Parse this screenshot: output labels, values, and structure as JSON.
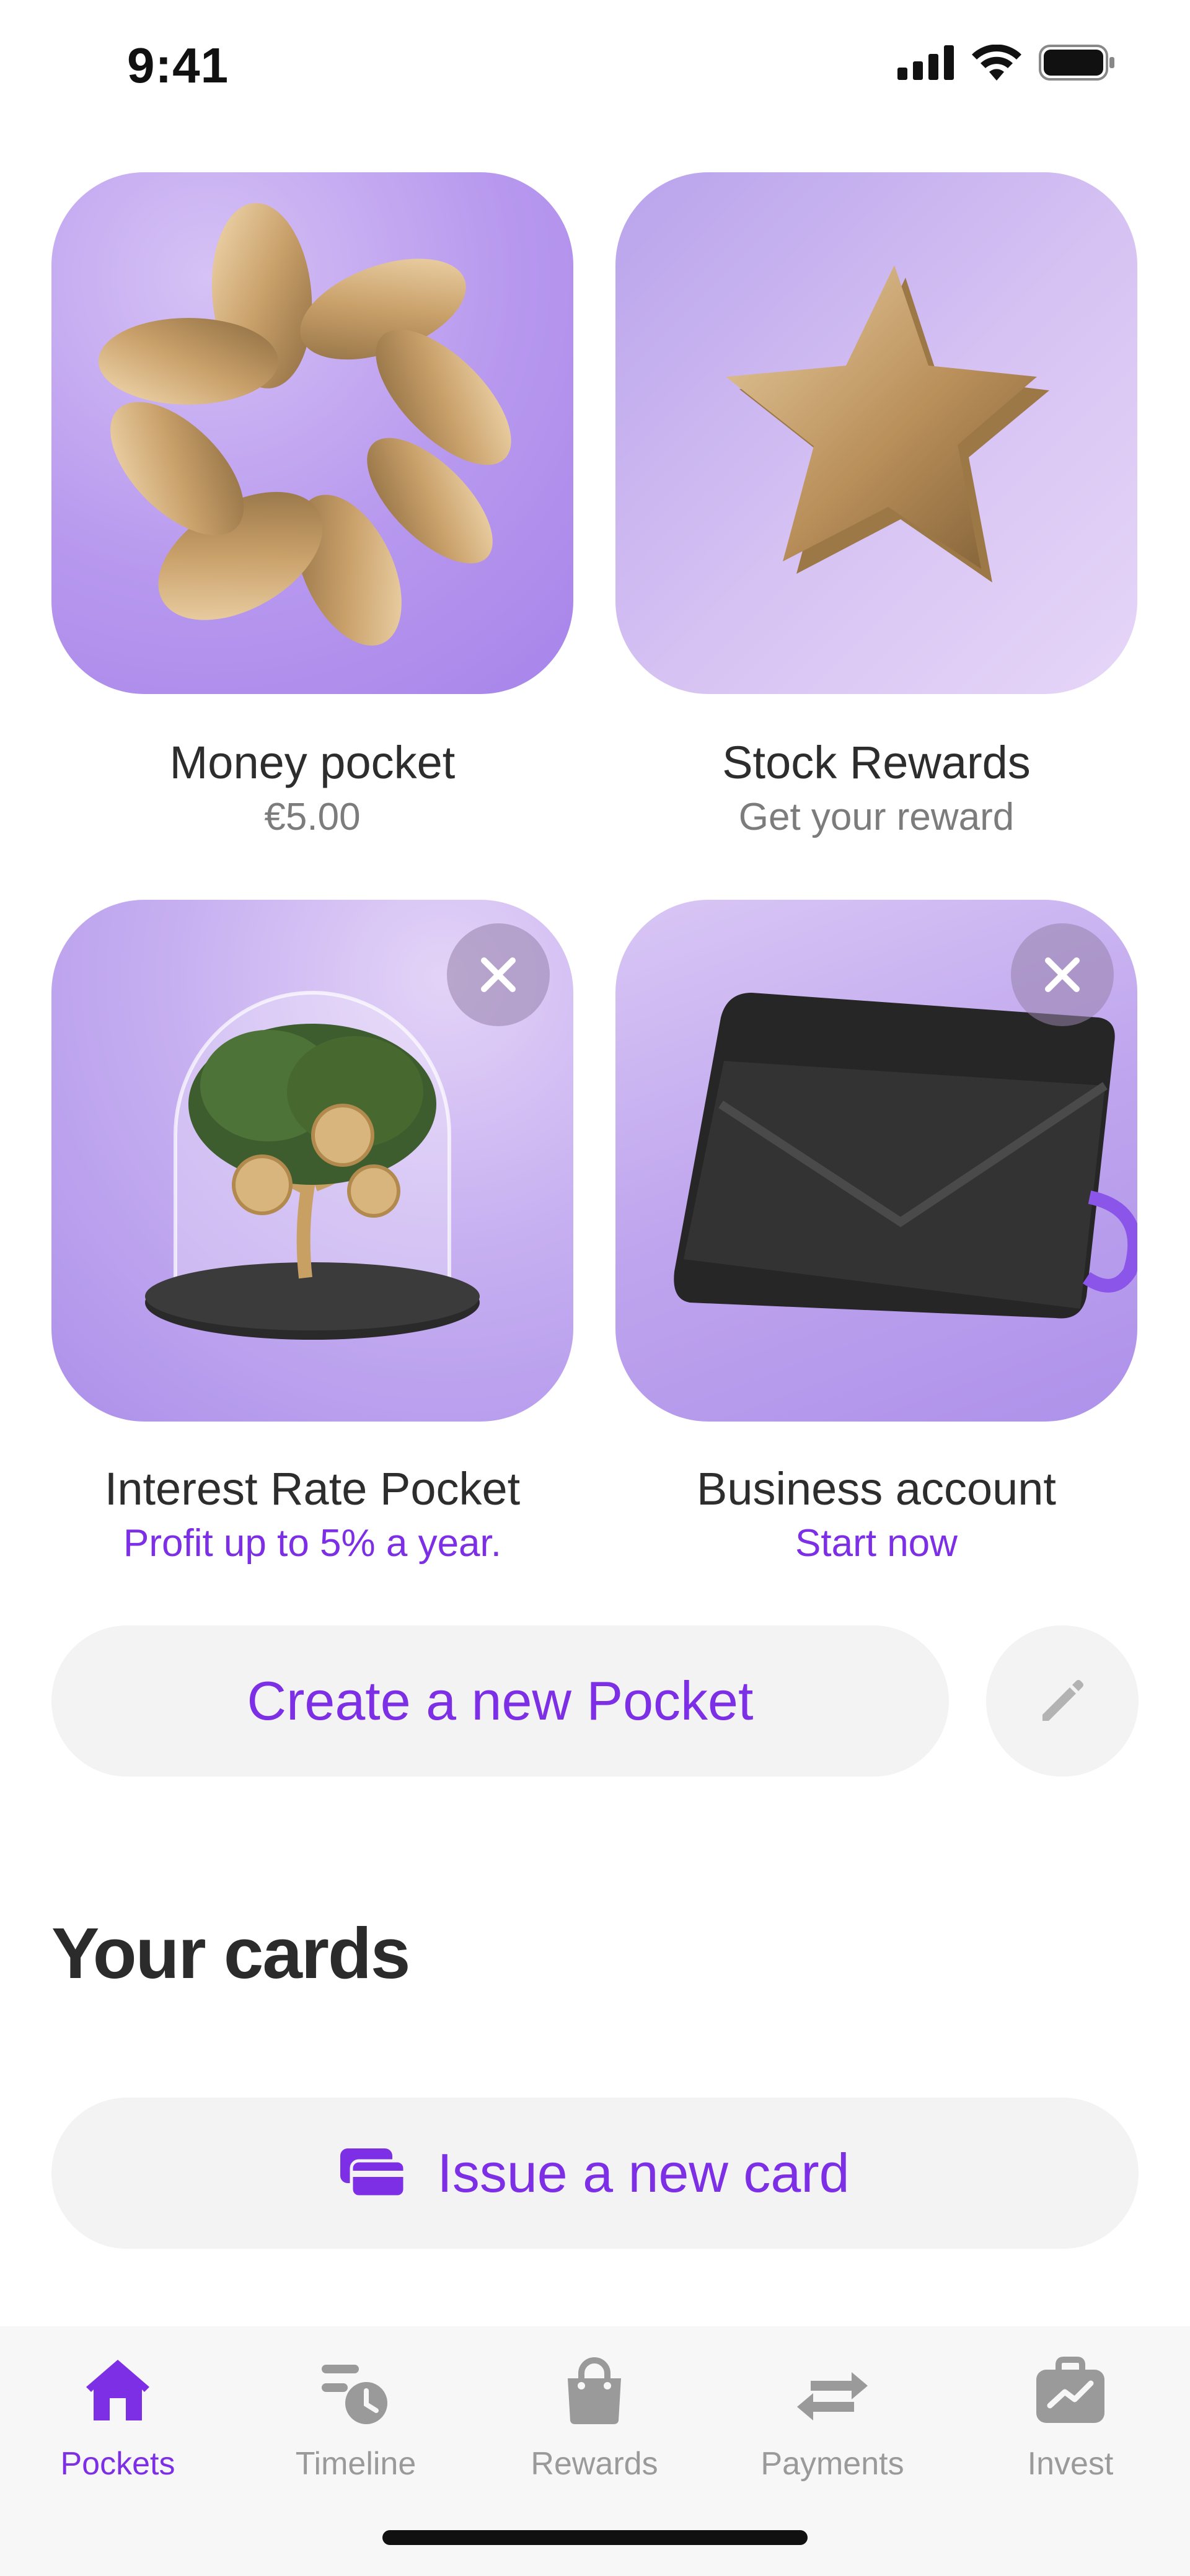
{
  "status_bar": {
    "time": "9:41"
  },
  "colors": {
    "accent": "#7d2fe6",
    "muted": "#9a9a9a",
    "tile_bg": "#b798ee"
  },
  "pockets": [
    {
      "title": "Money pocket",
      "subtitle": "€5.00",
      "icon": "coins-illustration",
      "closable": false
    },
    {
      "title": "Stock Rewards",
      "subtitle": "Get your reward",
      "icon": "star-illustration",
      "closable": false
    },
    {
      "title": "Interest Rate Pocket",
      "subtitle": "Profit up to 5% a year.",
      "icon": "money-tree-illustration",
      "closable": true
    },
    {
      "title": "Business account",
      "subtitle": "Start now",
      "icon": "wallet-illustration",
      "closable": true
    }
  ],
  "actions": {
    "create_pocket": "Create a new Pocket",
    "edit_icon": "pencil-icon"
  },
  "cards_section": {
    "title": "Your cards",
    "issue_card": "Issue a new card",
    "issue_icon": "cards-icon"
  },
  "tab_bar": {
    "active": "Pockets",
    "tabs": [
      {
        "label": "Pockets",
        "icon": "home-icon"
      },
      {
        "label": "Timeline",
        "icon": "timeline-icon"
      },
      {
        "label": "Rewards",
        "icon": "shopping-bag-icon"
      },
      {
        "label": "Payments",
        "icon": "transfer-arrows-icon"
      },
      {
        "label": "Invest",
        "icon": "briefcase-chart-icon"
      }
    ]
  }
}
